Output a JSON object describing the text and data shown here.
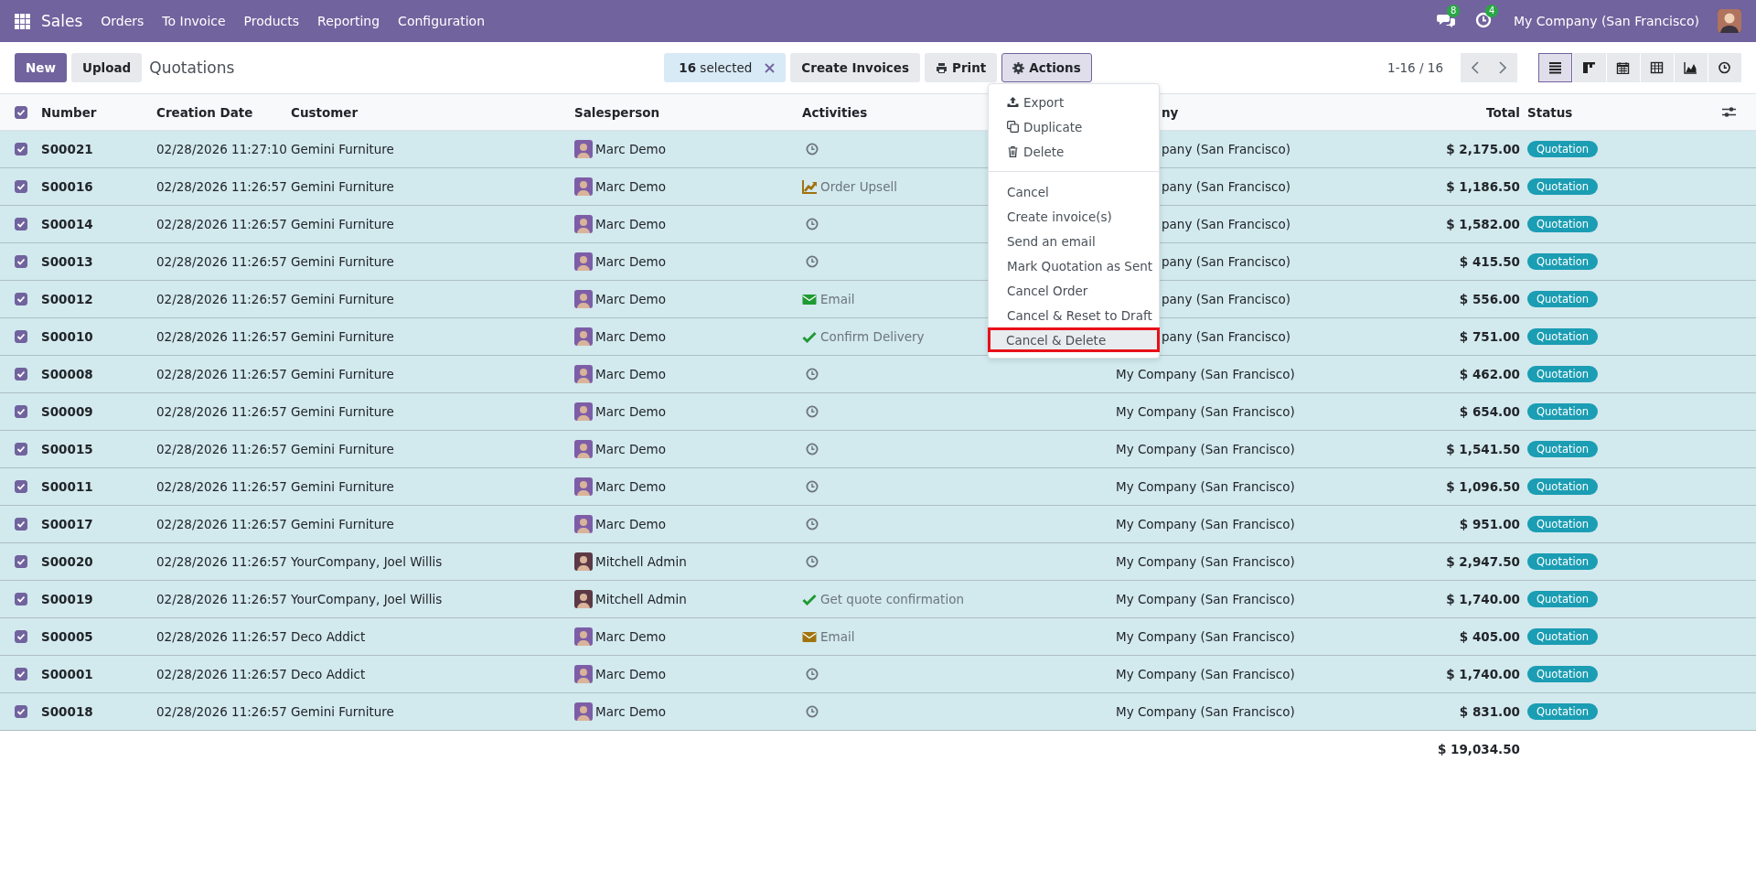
{
  "navbar": {
    "app": "Sales",
    "menus": [
      "Orders",
      "To Invoice",
      "Products",
      "Reporting",
      "Configuration"
    ],
    "chat_count": "8",
    "activity_count": "4",
    "company": "My Company (San Francisco)"
  },
  "control_panel": {
    "new_button": "New",
    "upload_button": "Upload",
    "title": "Quotations",
    "selection": {
      "count": "16",
      "label": "selected"
    },
    "buttons": [
      {
        "label": "Create Invoices",
        "kind": "plain",
        "open": false
      },
      {
        "label": "Print",
        "kind": "print",
        "open": false
      },
      {
        "label": "Actions",
        "kind": "gear",
        "open": true
      }
    ],
    "pager": "1-16 / 16",
    "views": [
      {
        "kind": "list",
        "selected": true
      },
      {
        "kind": "kanban",
        "selected": false
      },
      {
        "kind": "calendar",
        "selected": false
      },
      {
        "kind": "pivot",
        "selected": false
      },
      {
        "kind": "graph",
        "selected": false
      },
      {
        "kind": "activity",
        "selected": false
      }
    ]
  },
  "table": {
    "all_checked": true,
    "columns": [
      {
        "label": "Number",
        "partial": false
      },
      {
        "label": "Creation Date",
        "partial": false
      },
      {
        "label": "Customer",
        "partial": false
      },
      {
        "label": "Salesperson",
        "partial": false
      },
      {
        "label": "Activities",
        "partial": false
      },
      {
        "label": "ny",
        "partial": true
      },
      {
        "label": "Total",
        "partial": false
      },
      {
        "label": "Status",
        "partial": false
      }
    ],
    "rows": [
      {
        "selected": true,
        "number": "S00021",
        "date": "02/28/2026 11:27:10",
        "customer": "Gemini Furniture",
        "salesperson": {
          "name": "Marc Demo",
          "color": "#7d5ea6"
        },
        "activity": {
          "kind": "clock"
        },
        "company": {
          "text": "pany (San Francisco)",
          "partial": true
        },
        "total": "$ 2,175.00",
        "status": "Quotation"
      },
      {
        "selected": true,
        "number": "S00016",
        "date": "02/28/2026 11:26:57",
        "customer": "Gemini Furniture",
        "salesperson": {
          "name": "Marc Demo",
          "color": "#7d5ea6"
        },
        "activity": {
          "kind": "upsell",
          "label": "Order Upsell",
          "color": "#a0730d"
        },
        "company": {
          "text": "pany (San Francisco)",
          "partial": true
        },
        "total": "$ 1,186.50",
        "status": "Quotation"
      },
      {
        "selected": true,
        "number": "S00014",
        "date": "02/28/2026 11:26:57",
        "customer": "Gemini Furniture",
        "salesperson": {
          "name": "Marc Demo",
          "color": "#7d5ea6"
        },
        "activity": {
          "kind": "clock"
        },
        "company": {
          "text": "pany (San Francisco)",
          "partial": true
        },
        "total": "$ 1,582.00",
        "status": "Quotation"
      },
      {
        "selected": true,
        "number": "S00013",
        "date": "02/28/2026 11:26:57",
        "customer": "Gemini Furniture",
        "salesperson": {
          "name": "Marc Demo",
          "color": "#7d5ea6"
        },
        "activity": {
          "kind": "clock"
        },
        "company": {
          "text": "pany (San Francisco)",
          "partial": true
        },
        "total": "$ 415.50",
        "status": "Quotation"
      },
      {
        "selected": true,
        "number": "S00012",
        "date": "02/28/2026 11:26:57",
        "customer": "Gemini Furniture",
        "salesperson": {
          "name": "Marc Demo",
          "color": "#7d5ea6"
        },
        "activity": {
          "kind": "email",
          "label": "Email",
          "color": "#1e9a33"
        },
        "company": {
          "text": "pany (San Francisco)",
          "partial": true
        },
        "total": "$ 556.00",
        "status": "Quotation"
      },
      {
        "selected": true,
        "number": "S00010",
        "date": "02/28/2026 11:26:57",
        "customer": "Gemini Furniture",
        "salesperson": {
          "name": "Marc Demo",
          "color": "#7d5ea6"
        },
        "activity": {
          "kind": "check",
          "label": "Confirm Delivery",
          "color": "#1e9a33"
        },
        "company": {
          "text": "pany (San Francisco)",
          "partial": true
        },
        "total": "$ 751.00",
        "status": "Quotation"
      },
      {
        "selected": true,
        "number": "S00008",
        "date": "02/28/2026 11:26:57",
        "customer": "Gemini Furniture",
        "salesperson": {
          "name": "Marc Demo",
          "color": "#7d5ea6"
        },
        "activity": {
          "kind": "clock"
        },
        "company": {
          "text": "My Company (San Francisco)",
          "partial": false
        },
        "total": "$ 462.00",
        "status": "Quotation"
      },
      {
        "selected": true,
        "number": "S00009",
        "date": "02/28/2026 11:26:57",
        "customer": "Gemini Furniture",
        "salesperson": {
          "name": "Marc Demo",
          "color": "#7d5ea6"
        },
        "activity": {
          "kind": "clock"
        },
        "company": {
          "text": "My Company (San Francisco)",
          "partial": false
        },
        "total": "$ 654.00",
        "status": "Quotation"
      },
      {
        "selected": true,
        "number": "S00015",
        "date": "02/28/2026 11:26:57",
        "customer": "Gemini Furniture",
        "salesperson": {
          "name": "Marc Demo",
          "color": "#7d5ea6"
        },
        "activity": {
          "kind": "clock"
        },
        "company": {
          "text": "My Company (San Francisco)",
          "partial": false
        },
        "total": "$ 1,541.50",
        "status": "Quotation"
      },
      {
        "selected": true,
        "number": "S00011",
        "date": "02/28/2026 11:26:57",
        "customer": "Gemini Furniture",
        "salesperson": {
          "name": "Marc Demo",
          "color": "#7d5ea6"
        },
        "activity": {
          "kind": "clock"
        },
        "company": {
          "text": "My Company (San Francisco)",
          "partial": false
        },
        "total": "$ 1,096.50",
        "status": "Quotation"
      },
      {
        "selected": true,
        "number": "S00017",
        "date": "02/28/2026 11:26:57",
        "customer": "Gemini Furniture",
        "salesperson": {
          "name": "Marc Demo",
          "color": "#7d5ea6"
        },
        "activity": {
          "kind": "clock"
        },
        "company": {
          "text": "My Company (San Francisco)",
          "partial": false
        },
        "total": "$ 951.00",
        "status": "Quotation"
      },
      {
        "selected": true,
        "number": "S00020",
        "date": "02/28/2026 11:26:57",
        "customer": "YourCompany, Joel Willis",
        "salesperson": {
          "name": "Mitchell Admin",
          "color": "#5c3945"
        },
        "activity": {
          "kind": "clock"
        },
        "company": {
          "text": "My Company (San Francisco)",
          "partial": false
        },
        "total": "$ 2,947.50",
        "status": "Quotation"
      },
      {
        "selected": true,
        "number": "S00019",
        "date": "02/28/2026 11:26:57",
        "customer": "YourCompany, Joel Willis",
        "salesperson": {
          "name": "Mitchell Admin",
          "color": "#5c3945"
        },
        "activity": {
          "kind": "check",
          "label": "Get quote confirmation",
          "color": "#1e9a33"
        },
        "company": {
          "text": "My Company (San Francisco)",
          "partial": false
        },
        "total": "$ 1,740.00",
        "status": "Quotation"
      },
      {
        "selected": true,
        "number": "S00005",
        "date": "02/28/2026 11:26:57",
        "customer": "Deco Addict",
        "salesperson": {
          "name": "Marc Demo",
          "color": "#7d5ea6"
        },
        "activity": {
          "kind": "email",
          "label": "Email",
          "color": "#a0730d"
        },
        "company": {
          "text": "My Company (San Francisco)",
          "partial": false
        },
        "total": "$ 405.00",
        "status": "Quotation"
      },
      {
        "selected": true,
        "number": "S00001",
        "date": "02/28/2026 11:26:57",
        "customer": "Deco Addict",
        "salesperson": {
          "name": "Marc Demo",
          "color": "#7d5ea6"
        },
        "activity": {
          "kind": "clock"
        },
        "company": {
          "text": "My Company (San Francisco)",
          "partial": false
        },
        "total": "$ 1,740.00",
        "status": "Quotation"
      },
      {
        "selected": true,
        "number": "S00018",
        "date": "02/28/2026 11:26:57",
        "customer": "Gemini Furniture",
        "salesperson": {
          "name": "Marc Demo",
          "color": "#7d5ea6"
        },
        "activity": {
          "kind": "clock"
        },
        "company": {
          "text": "My Company (San Francisco)",
          "partial": false
        },
        "total": "$ 831.00",
        "status": "Quotation"
      }
    ],
    "grand_total": "$ 19,034.50"
  },
  "action_menu": {
    "groups": [
      {
        "items": [
          {
            "label": "Export",
            "kind": "export",
            "highlighted": false
          },
          {
            "label": "Duplicate",
            "kind": "duplicate",
            "highlighted": false
          },
          {
            "label": "Delete",
            "kind": "delete",
            "highlighted": false
          }
        ]
      },
      {
        "items": [
          {
            "label": "Cancel",
            "kind": "plain",
            "highlighted": false
          },
          {
            "label": "Create invoice(s)",
            "kind": "plain",
            "highlighted": false
          },
          {
            "label": "Send an email",
            "kind": "plain",
            "highlighted": false
          },
          {
            "label": "Mark Quotation as Sent",
            "kind": "plain",
            "highlighted": false
          },
          {
            "label": "Cancel Order",
            "kind": "plain",
            "highlighted": false
          },
          {
            "label": "Cancel & Reset to Draft",
            "kind": "plain",
            "highlighted": false
          },
          {
            "label": "Cancel & Delete",
            "kind": "plain",
            "highlighted": true
          }
        ]
      }
    ]
  }
}
